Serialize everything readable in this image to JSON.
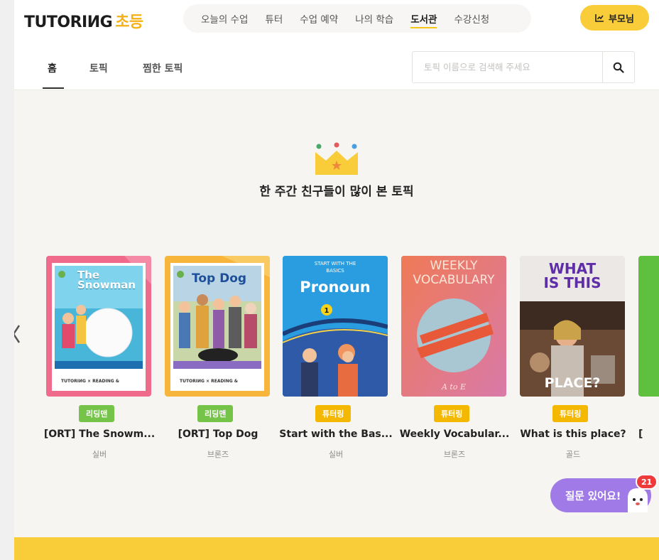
{
  "header": {
    "logo": {
      "main": "TUTORIИG",
      "sub": "초등"
    },
    "nav": [
      {
        "label": "오늘의 수업",
        "active": false
      },
      {
        "label": "튜터",
        "active": false
      },
      {
        "label": "수업 예약",
        "active": false
      },
      {
        "label": "나의 학습",
        "active": false
      },
      {
        "label": "도서관",
        "active": true
      },
      {
        "label": "수강신청",
        "active": false
      }
    ],
    "parent_button": "부모님",
    "parent_icon": "chart-icon"
  },
  "subnav": {
    "tabs": [
      {
        "label": "홈",
        "active": true
      },
      {
        "label": "토픽",
        "active": false
      },
      {
        "label": "찜한 토픽",
        "active": false
      }
    ],
    "search": {
      "placeholder": "토픽 이름으로 검색해 주세요",
      "value": "",
      "icon": "search-icon"
    }
  },
  "section": {
    "title": "한 주간 친구들이 많이 본 토픽",
    "icon": "crown-icon"
  },
  "books": [
    {
      "title": "[ORT] The Snowm...",
      "level": "실버",
      "badge": "리딩맨",
      "badge_color": "green",
      "cover_text": "The Snowman",
      "cover_footer": "TUTORIИG × READING &",
      "cover_bg": "#f06a8c"
    },
    {
      "title": "[ORT] Top Dog",
      "level": "브론즈",
      "badge": "리딩맨",
      "badge_color": "green",
      "cover_text": "Top Dog",
      "cover_footer": "TUTORIИG × READING &",
      "cover_bg": "#f7b53c"
    },
    {
      "title": "Start with the Bas...",
      "level": "실버",
      "badge": "튜터링",
      "badge_color": "yellow",
      "cover_kicker_1": "START WITH THE",
      "cover_kicker_2": "BASICS",
      "cover_text": "Pronoun",
      "cover_number": "1",
      "cover_bg": "#1f8fd6"
    },
    {
      "title": "Weekly Vocabular...",
      "level": "브론즈",
      "badge": "튜터링",
      "badge_color": "yellow",
      "cover_text_1": "WEEKLY",
      "cover_text_2": "VOCABULARY",
      "cover_footer": "A to E",
      "cover_bg": "#e8735a"
    },
    {
      "title": "What is this place?",
      "level": "골드",
      "badge": "튜터링",
      "badge_color": "yellow",
      "cover_text_1": "WHAT",
      "cover_text_2": "IS THIS",
      "cover_footer": "PLACE?",
      "cover_bg": "#ece8e6"
    }
  ],
  "peek_title": "[",
  "chat": {
    "label": "질문 있어요!",
    "badge_count": "21"
  },
  "colors": {
    "brand_yellow": "#f9cd3a",
    "badge_green": "#76c34a",
    "badge_yellow": "#f5b800",
    "chat_purple": "#a07be8",
    "notification_red": "#ee3a3a"
  }
}
